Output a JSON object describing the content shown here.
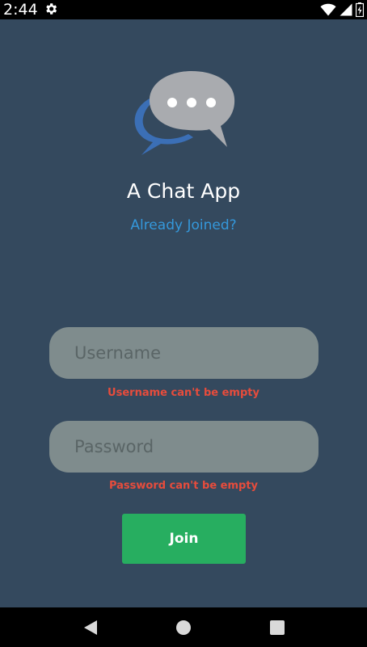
{
  "status_bar": {
    "time": "2:44",
    "icons": [
      "settings-gear-icon",
      "wifi-icon",
      "cellular-signal-icon",
      "battery-icon"
    ]
  },
  "app": {
    "title": "A Chat App",
    "logo_icon": "chat-bubbles-icon",
    "already_joined_link": "Already Joined?"
  },
  "form": {
    "username": {
      "placeholder": "Username",
      "value": "",
      "error": "Username can't be empty"
    },
    "password": {
      "placeholder": "Password",
      "value": "",
      "error": "Password can't be empty"
    },
    "join_label": "Join"
  },
  "nav_bar": {
    "buttons": [
      "back-icon",
      "home-icon",
      "recents-icon"
    ]
  },
  "colors": {
    "background": "#34495e",
    "link": "#3498db",
    "input_bg": "#7f8c8d",
    "error": "#e74c3c",
    "button": "#27ae60"
  }
}
